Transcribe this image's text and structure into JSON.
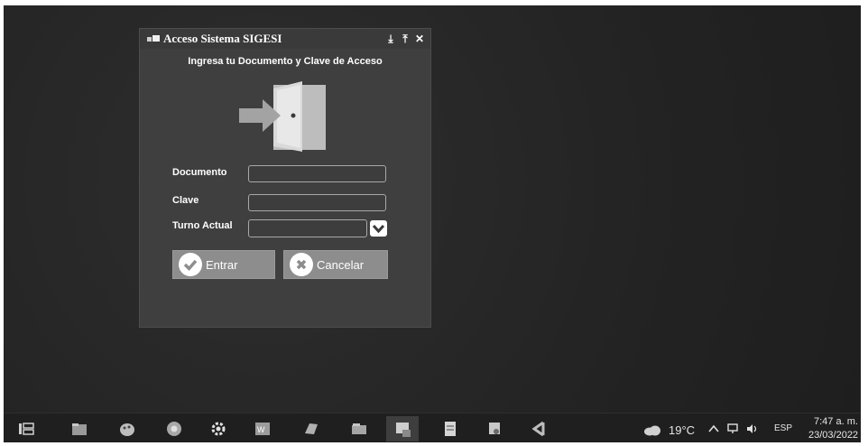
{
  "window": {
    "title": "Acceso Sistema SIGESI",
    "controls": {
      "minimize": "⤓",
      "pin": "⤒",
      "close": "✕"
    },
    "subtitle": "Ingresa tu Documento y Clave de Acceso"
  },
  "form": {
    "documento_label": "Documento",
    "documento_value": "",
    "clave_label": "Clave",
    "clave_value": "",
    "turno_label": "Turno Actual",
    "turno_value": ""
  },
  "buttons": {
    "entrar": "Entrar",
    "cancelar": "Cancelar"
  },
  "taskbar": {
    "icons": [
      "task-view-icon",
      "file-explorer-icon",
      "paint-icon",
      "chrome-icon",
      "settings-icon",
      "word-icon",
      "app-icon",
      "folder-icon",
      "sigesi-app-icon",
      "document-icon",
      "paint-brush-icon",
      "vscode-icon"
    ],
    "weather": "19°C",
    "language": "ESP",
    "time": "7:47 a. m.",
    "date": "23/03/2022"
  },
  "colors": {
    "desktop": "#262626",
    "window": "#3f3f3f",
    "button": "#8d8d8d",
    "door": "#d4d4d4",
    "arrow": "#a8a8a8"
  }
}
